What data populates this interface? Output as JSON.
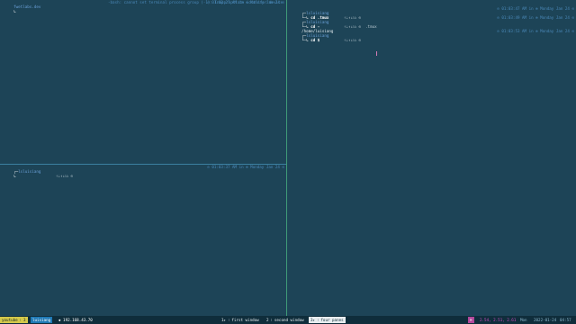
{
  "panes": {
    "top_left": {
      "line1_left": "fwetlabs.dev",
      "line1_center": "-bash: cannot set terminal process group (-1): Inappropriate ioctl for device",
      "line1_right": "⊙ 01:03:27 AM in ⊕ Monday Jan 24 ⊙",
      "prompt": "↳"
    },
    "bottom_left": {
      "user": "lsluisiang",
      "git_info": "⇡⇣↑↓⁝⌂ ⊙",
      "right": "⊙ 01:03:37 AM in ⊕ Monday Jan 24 ⊙",
      "prompt": "↳"
    },
    "right": {
      "user": "lsluisiang",
      "rows": [
        {
          "user": "lsluisiang",
          "git": "⇡⇣↑↓⁝⌂ ⊙",
          "right": "⊙ 01:03:47 AM in ⊕ Monday Jan 24 ⊙",
          "cmd": "cd .tmux"
        },
        {
          "user": "lsluisiang",
          "git": "⇡⇣↑↓⁝⌂ ⊙  .tmux",
          "right": "⊙ 01:03:49 AM in ⊕ Monday Jan 24 ⊙",
          "cmd": "cd -"
        },
        {
          "user": "lsluisiang",
          "git": "⇡⇣↑↓⁝⌂ ⊙",
          "right": "⊙ 01:03:53 AM in ⊕ Monday Jan 24 ⊙",
          "cmd": "cd $"
        }
      ],
      "output": "/home/luisiang"
    }
  },
  "statusbar": {
    "session": "youtube ⁝ 3",
    "host": "luisiang",
    "ip": "◆ 192.168.43.70",
    "window1": "1▸ ⁝ first window",
    "window2": "2 ⁝ second window",
    "window3": "3▸ ⁝ four panes",
    "prefix": "⌘",
    "load": "2.54, 2.51, 2.61",
    "day": "Mon",
    "date": "2022-01-24",
    "time": "04:57"
  },
  "colors": {
    "background": "#1d4457",
    "pane_border_active": "#3f9a78",
    "pane_border_inactive": "#3b7fa0",
    "status_session": "#d4c94b",
    "status_host": "#1f79b5",
    "status_prefix": "#b1489a"
  },
  "icons": [
    "prompt-arrow-icon",
    "git-status-icon",
    "clock-icon"
  ]
}
